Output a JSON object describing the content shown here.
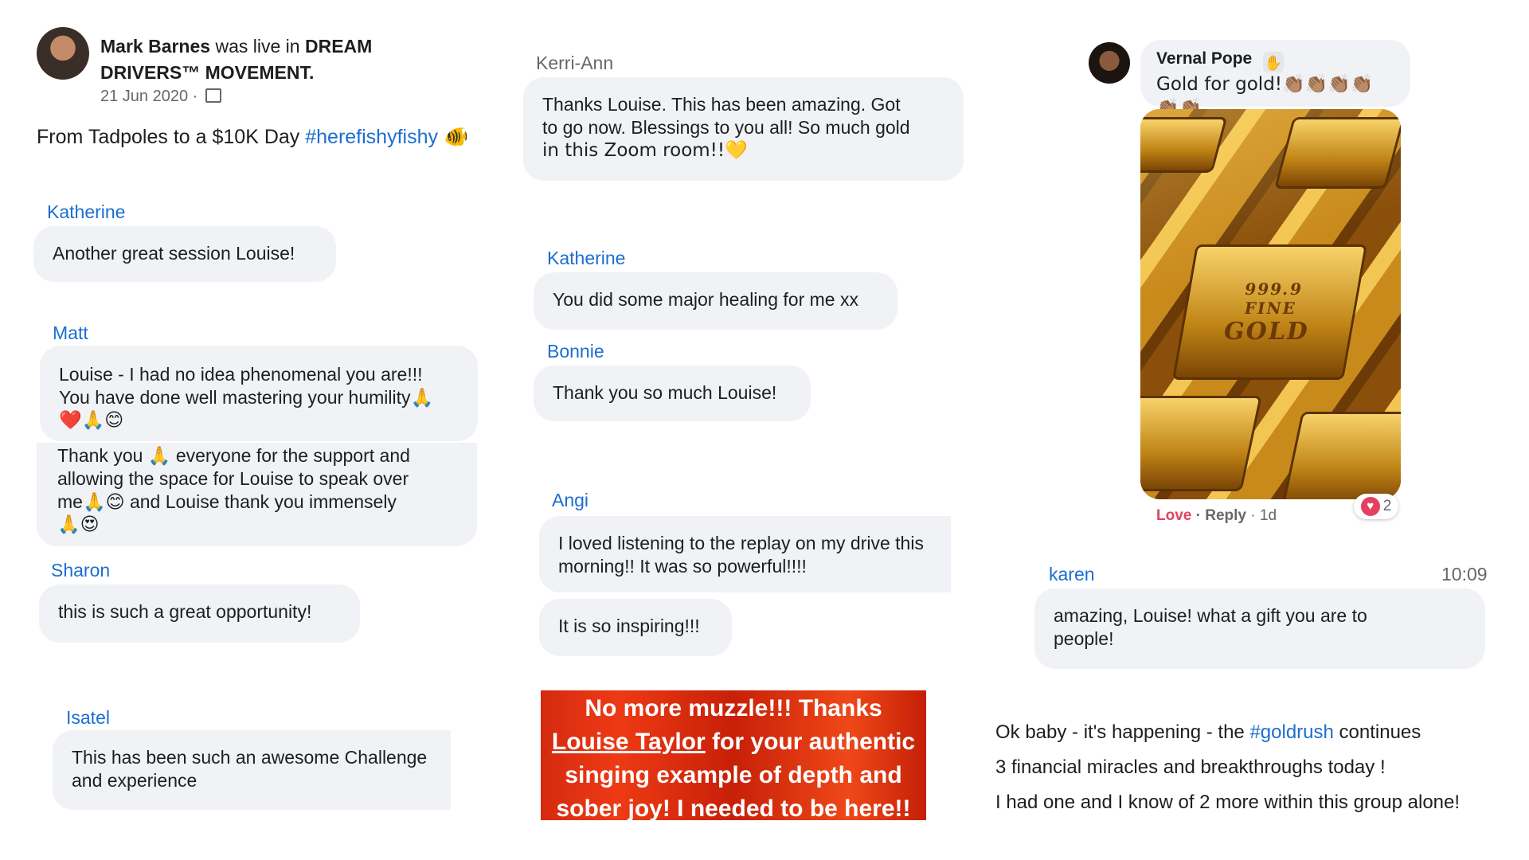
{
  "post": {
    "author": "Mark Barnes",
    "action": "was live in",
    "group": "DREAM DRIVERS™ MOVEMENT.",
    "date": "21 Jun 2020 ·",
    "privacy_icon": "group-icon",
    "caption": "From Tadpoles to a $10K Day",
    "hashtag": "#herefishyfishy",
    "caption_emoji": "🐠"
  },
  "col1": {
    "c1_name": "Katherine",
    "c1_text": "Another great session Louise!",
    "c2_name": "Matt",
    "c2_line1": "Louise - I had no idea phenomenal you are!!!",
    "c2_line2": "You have done well mastering your humility🙏",
    "c2_line3": "❤️🙏😊",
    "c3_line1": "Thank you 🙏 everyone for the support and",
    "c3_line2": "allowing the space for Louise to speak over",
    "c3_line3": "me🙏😊 and Louise thank you immensely",
    "c3_line4": "🙏😍",
    "c4_name": "Sharon",
    "c4_text": "this is such a great opportunity!",
    "c5_name": "Isatel",
    "c5_line1": "This has been such an awesome Challenge",
    "c5_line2": "and experience"
  },
  "col2": {
    "c1_name": "Kerri-Ann",
    "c1_line1": "Thanks Louise.  This has been amazing.  Got",
    "c1_line2": "to go now.  Blessings to you all! So much gold",
    "c1_line3": "in this Zoom room!!💛",
    "c2_name": "Katherine",
    "c2_text": "You did some major healing for me xx",
    "c3_name": "Bonnie",
    "c3_text": "Thank you so much Louise!",
    "c4_name": "Angi",
    "c4_line1": "I loved listening to the replay on my drive this",
    "c4_line2": "morning!! It was so powerful!!!!",
    "c5_text": "It is so inspiring!!!",
    "banner_line1": "No more muzzle!!! Thanks",
    "banner_link": "Louise Taylor",
    "banner_line2_rest": " for your authentic",
    "banner_line3": "singing example of depth and",
    "banner_line4": "sober joy! I needed to be here!!"
  },
  "col3": {
    "c1_name": "Vernal Pope",
    "c1_badge_icon": "wave-hand-icon",
    "c1_text": "Gold for gold!👏🏽👏🏽👏🏽👏🏽👏🏽👏🏽",
    "image_desc_icon": "gold-bars-image",
    "bar_text_1": "999.9",
    "bar_text_2": "FINE",
    "bar_text_3": "GOLD",
    "love_label": "Love",
    "reply_label": "· Reply",
    "age": "· 1d",
    "reaction_count": "2",
    "c2_name": "karen",
    "c2_time": "10:09",
    "c2_line1": "amazing, Louise!  what a gift you are to",
    "c2_line2": "people!",
    "p1_a": "Ok baby - it's happening - the ",
    "p1_hashtag": "#goldrush",
    "p1_b": " continues",
    "p2": "3 financial miracles and breakthroughs today !",
    "p3": "I had one and I know of 2 more within this group alone!"
  },
  "colors": {
    "name_blue": "#1c6dd0",
    "bubble_bg": "#f0f2f5",
    "love_red": "#e4405f",
    "banner_red": "#d52a10"
  }
}
